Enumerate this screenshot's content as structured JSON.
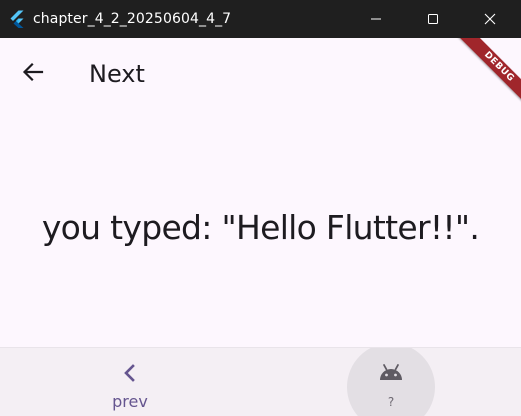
{
  "window": {
    "title": "chapter_4_2_20250604_4_7",
    "app_icon": "flutter-logo-icon",
    "controls": [
      "minimize-icon",
      "maximize-icon",
      "close-icon"
    ]
  },
  "appbar": {
    "back_icon": "arrow-left-icon",
    "title": "Next"
  },
  "debug_banner": {
    "label": "DEBUG",
    "color": "#a0262b"
  },
  "main": {
    "typed_message": "you typed: \"Hello Flutter!!\"."
  },
  "bottom_nav": {
    "items": [
      {
        "icon": "chevron-left-icon",
        "label": "prev",
        "color": "#65558f"
      },
      {
        "icon": "android-icon",
        "label": "?",
        "color": "#5f5b63"
      }
    ]
  },
  "colors": {
    "titlebar": "#1f1f1f",
    "background": "#fdf7fe",
    "nav_background": "#f4eff4",
    "text": "#1d1b20"
  }
}
